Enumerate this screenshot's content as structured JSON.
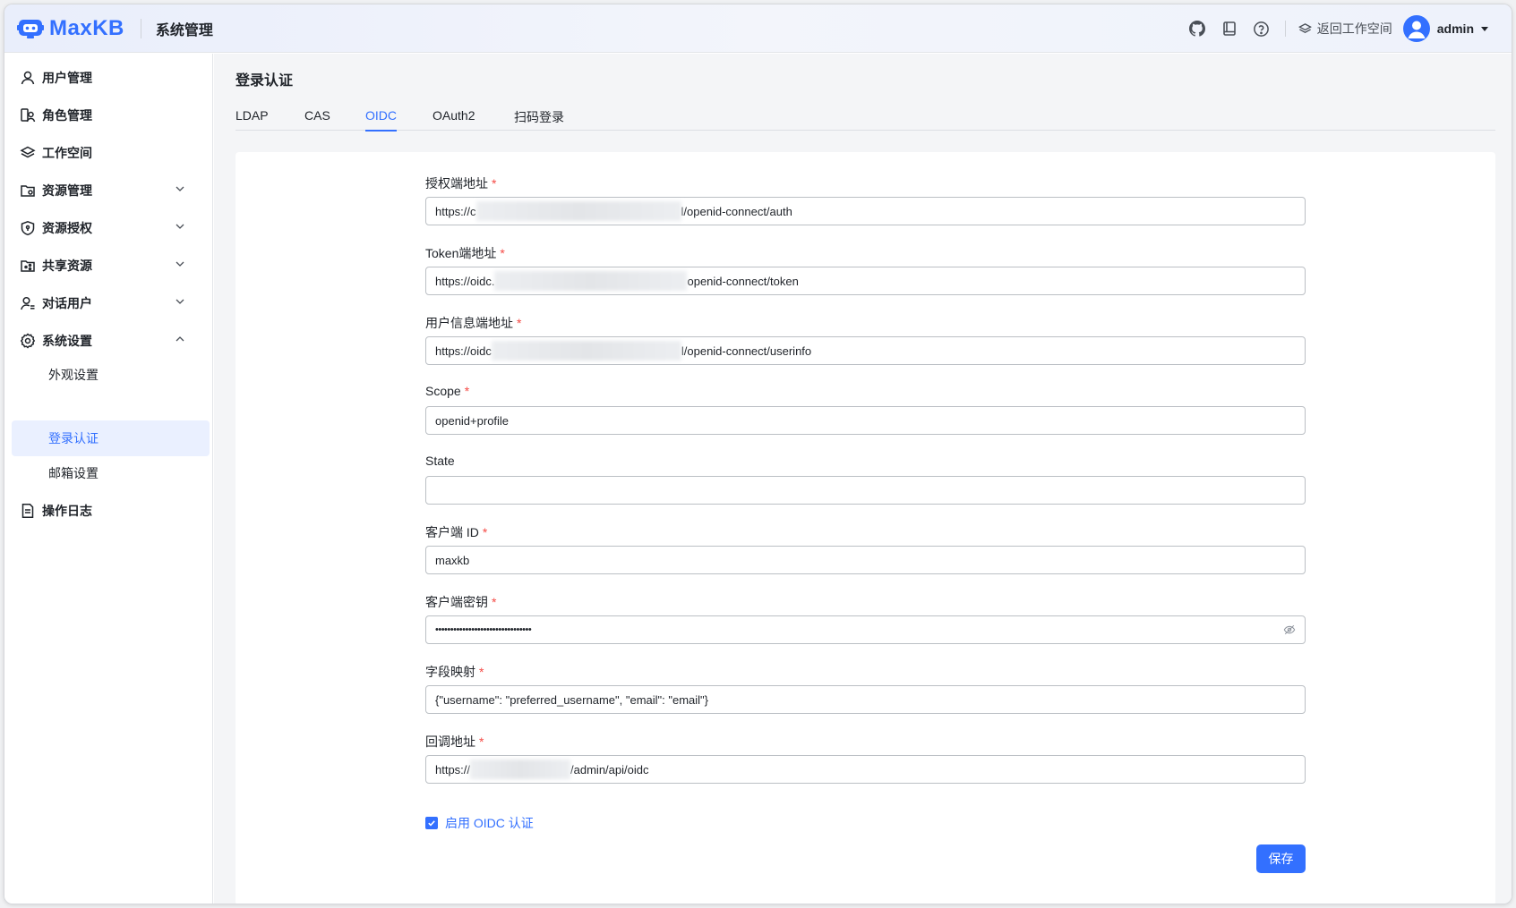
{
  "app": {
    "logo_text": "MaxKB",
    "section_title": "系统管理"
  },
  "header": {
    "icons": [
      "github-icon",
      "book-icon",
      "help-icon"
    ],
    "back_workspace_label": "返回工作空间",
    "user_name": "admin"
  },
  "sidebar": {
    "items": [
      {
        "label": "用户管理",
        "icon": "user-icon"
      },
      {
        "label": "角色管理",
        "icon": "role-icon"
      },
      {
        "label": "工作空间",
        "icon": "layers-icon"
      },
      {
        "label": "资源管理",
        "icon": "folder-gear-icon",
        "expandable": true,
        "expanded": false
      },
      {
        "label": "资源授权",
        "icon": "shield-icon",
        "expandable": true,
        "expanded": false
      },
      {
        "label": "共享资源",
        "icon": "share-folder-icon",
        "expandable": true,
        "expanded": false
      },
      {
        "label": "对话用户",
        "icon": "chat-user-icon",
        "expandable": true,
        "expanded": false
      },
      {
        "label": "系统设置",
        "icon": "gear-icon",
        "expandable": true,
        "expanded": true
      },
      {
        "label": "操作日志",
        "icon": "log-icon"
      }
    ],
    "sub_items": [
      {
        "label": "外观设置",
        "active": false
      },
      {
        "label": "登录认证",
        "active": true
      },
      {
        "label": "邮箱设置",
        "active": false
      }
    ]
  },
  "main": {
    "page_title": "登录认证",
    "tabs": [
      {
        "label": "LDAP",
        "active": false
      },
      {
        "label": "CAS",
        "active": false
      },
      {
        "label": "OIDC",
        "active": true
      },
      {
        "label": "OAuth2",
        "active": false
      },
      {
        "label": "扫码登录",
        "active": false
      }
    ],
    "form": {
      "auth_endpoint": {
        "label": "授权端地址",
        "required": true,
        "value_prefix": "https://c",
        "value_suffix": "l/openid-connect/auth"
      },
      "token_endpoint": {
        "label": "Token端地址",
        "required": true,
        "value_prefix": "https://oidc.",
        "value_suffix": "openid-connect/token"
      },
      "userinfo_endpoint": {
        "label": "用户信息端地址",
        "required": true,
        "value_prefix": "https://oidc",
        "value_suffix": "l/openid-connect/userinfo"
      },
      "scope": {
        "label": "Scope",
        "required": true,
        "value": "openid+profile"
      },
      "state": {
        "label": "State",
        "required": false,
        "value": ""
      },
      "client_id": {
        "label": "客户端 ID",
        "required": true,
        "value": "maxkb"
      },
      "client_secret": {
        "label": "客户端密钥",
        "required": true,
        "value": "••••••••••••••••••••••••••••••••"
      },
      "field_mapping": {
        "label": "字段映射",
        "required": true,
        "value": "{\"username\": \"preferred_username\", \"email\": \"email\"}"
      },
      "redirect_url": {
        "label": "回调地址",
        "required": true,
        "value_prefix": "https://",
        "value_suffix": "/admin/api/oidc"
      },
      "enable_checkbox": {
        "label": "启用 OIDC 认证",
        "checked": true
      },
      "save_label": "保存"
    },
    "required_mark": "*"
  },
  "colors": {
    "accent": "#3370ff",
    "required": "#f54a45"
  }
}
